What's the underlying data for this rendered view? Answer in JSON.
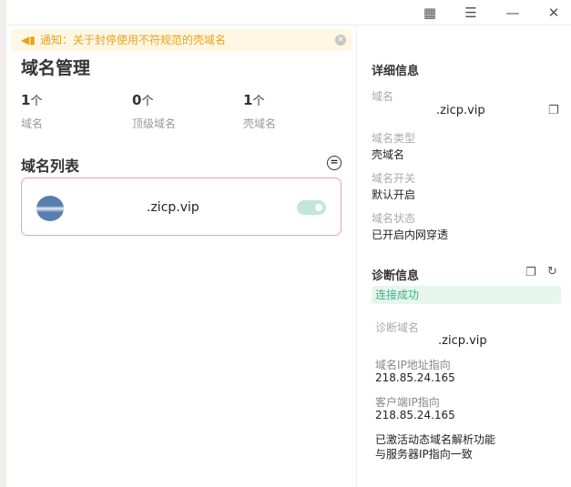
{
  "notice": {
    "text": "通知：关于封停使用不符规范的壳域名"
  },
  "main": {
    "title": "域名管理",
    "stats": [
      {
        "value": "1",
        "unit": "个",
        "label": "域名"
      },
      {
        "value": "0",
        "unit": "个",
        "label": "顶级域名"
      },
      {
        "value": "1",
        "unit": "个",
        "label": "壳域名"
      }
    ],
    "list_title": "域名列表",
    "domains": [
      {
        "name": ".zicp.vip",
        "enabled": true
      }
    ]
  },
  "details": {
    "title": "详细信息",
    "domain_label": "域名",
    "domain_value": ".zicp.vip",
    "type_label": "域名类型",
    "type_value": "壳域名",
    "switch_label": "域名开关",
    "switch_value": "默认开启",
    "status_label": "域名状态",
    "status_value": "已开启内网穿透"
  },
  "diagnosis": {
    "title": "诊断信息",
    "status": "连接成功",
    "domain_label": "诊断域名",
    "domain_value": ".zicp.vip",
    "dns_label": "域名IP地址指向",
    "dns_value": "218.85.24.165",
    "client_label": "客户端IP指向",
    "client_value": "218.85.24.165",
    "result_line1": "已激活动态域名解析功能",
    "result_line2": "与服务器IP指向一致"
  },
  "colors": {
    "accent": "#3bb37f",
    "notice": "#e8a21d",
    "card_border": "#f39bb2"
  }
}
